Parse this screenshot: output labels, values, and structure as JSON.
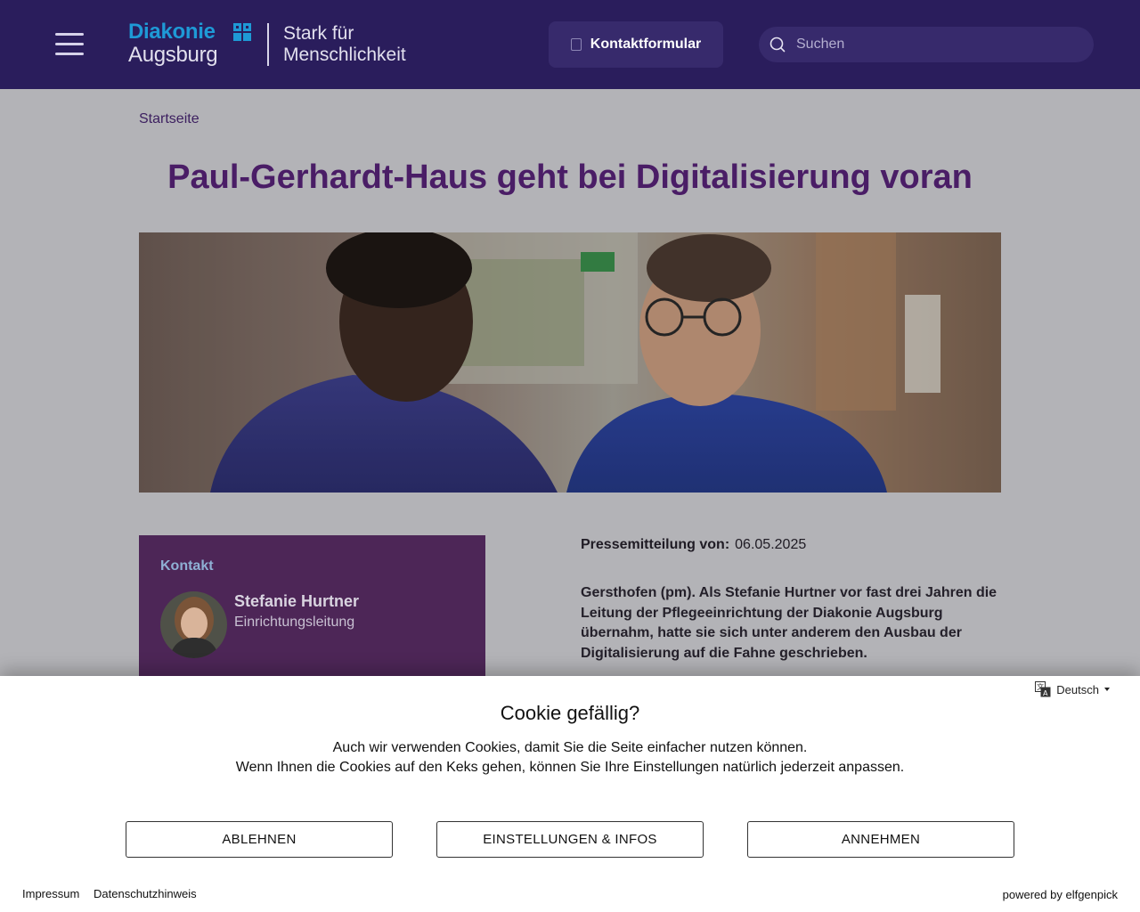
{
  "header": {
    "logo": {
      "brand": "Diakonie",
      "city": "Augsburg",
      "slogan_line1": "Stark für",
      "slogan_line2": "Menschlichkeit"
    },
    "contact_button_label": "Kontaktformular",
    "search_placeholder": "Suchen",
    "colors": {
      "background": "#2a1d5c",
      "brand_blue": "#1e9ad6"
    }
  },
  "breadcrumb": {
    "items": [
      "Startseite"
    ]
  },
  "article": {
    "title": "Paul-Gerhardt-Haus geht bei Digitalisierung voran",
    "press_label": "Pressemitteilung von:",
    "press_date": "06.05.2025",
    "lead": "Gersthofen (pm). Als Stefanie Hurtner vor fast drei Jahren die Leitung der Pflegeeinrichtung der Diakonie Augsburg übernahm, hatte sie sich unter anderem den Ausbau der Digitalisierung auf die Fahne geschrieben."
  },
  "contact_card": {
    "label": "Kontakt",
    "name": "Stefanie Hurtner",
    "role": "Einrichtungsleitung"
  },
  "cookie": {
    "language": "Deutsch",
    "title": "Cookie gefällig?",
    "text_line1": "Auch wir verwenden Cookies, damit Sie die Seite einfacher nutzen können.",
    "text_line2": "Wenn Ihnen die Cookies auf den Keks gehen, können Sie Ihre Einstellungen natürlich jederzeit anpassen.",
    "decline_label": "ABLEHNEN",
    "settings_label": "EINSTELLUNGEN & INFOS",
    "accept_label": "ANNEHMEN",
    "impressum": "Impressum",
    "privacy": "Datenschutzhinweis",
    "powered_by": "powered by elfgenpick"
  }
}
